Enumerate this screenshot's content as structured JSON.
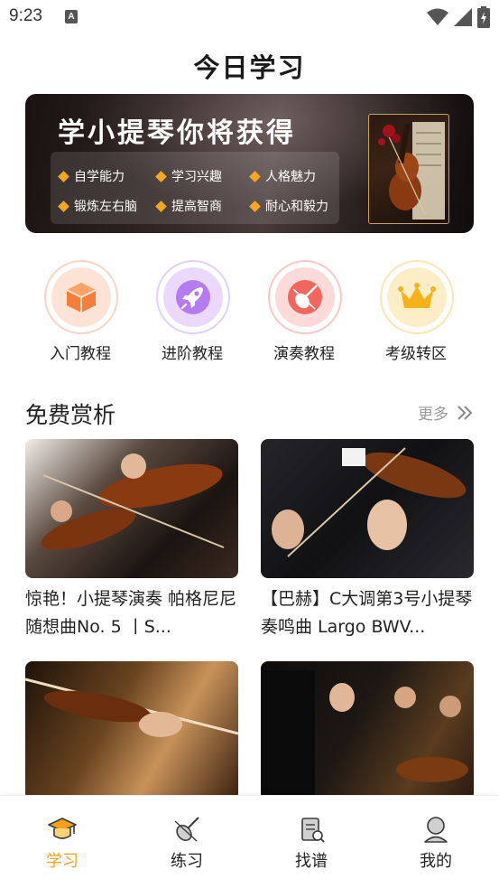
{
  "status_bar": {
    "time": "9:23",
    "notif_icon_letter": "A"
  },
  "page": {
    "title": "今日学习"
  },
  "banner": {
    "title": "学小提琴你将获得",
    "benefits": [
      "自学能力",
      "学习兴趣",
      "人格魅力",
      "锻炼左右脑",
      "提高智商",
      "耐心和毅力"
    ],
    "accent_color": "#f5a623"
  },
  "categories": [
    {
      "label": "入门教程",
      "icon": "cube-icon"
    },
    {
      "label": "进阶教程",
      "icon": "rocket-icon"
    },
    {
      "label": "演奏教程",
      "icon": "violin-icon"
    },
    {
      "label": "考级转区",
      "icon": "crown-icon"
    }
  ],
  "free_section": {
    "title": "免费赏析",
    "more_label": "更多",
    "cards": [
      {
        "title": "惊艳！小提琴演奏 帕格尼尼随想曲No. 5 丨S..."
      },
      {
        "title": "【巴赫】C大调第3号小提琴奏鸣曲 Largo BWV..."
      },
      {
        "title": ""
      },
      {
        "title": ""
      }
    ]
  },
  "tabbar": {
    "tabs": [
      {
        "label": "学习",
        "icon": "graduation-cap-icon",
        "active": true
      },
      {
        "label": "练习",
        "icon": "violin-icon",
        "active": false
      },
      {
        "label": "找谱",
        "icon": "sheet-music-icon",
        "active": false
      },
      {
        "label": "我的",
        "icon": "user-icon",
        "active": false
      }
    ],
    "active_color": "#f5a21a"
  }
}
